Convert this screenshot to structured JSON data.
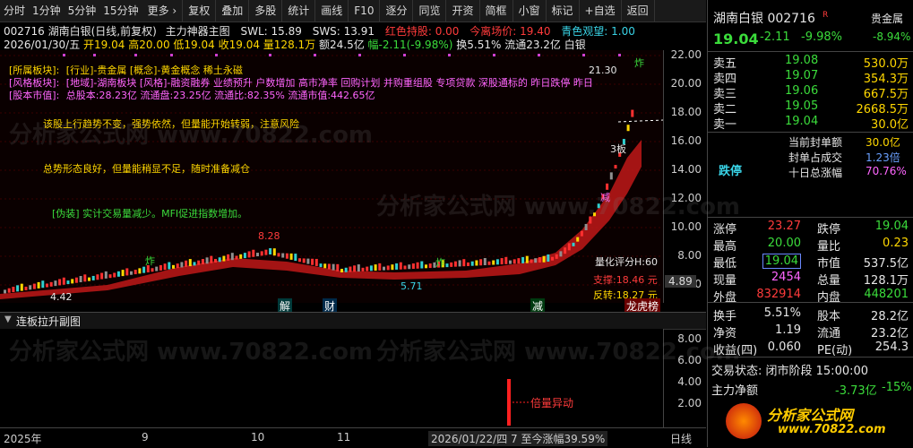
{
  "toolbar": {
    "periods": [
      "分时",
      "1分钟",
      "5分钟",
      "15分钟",
      "更多 ›"
    ],
    "buttons": [
      "复权",
      "叠加",
      "多股",
      "统计",
      "画线",
      "F10",
      "逐分",
      "同览",
      "开资",
      "简框",
      "小窗",
      "标记",
      "+自选",
      "返回"
    ]
  },
  "header": {
    "code_name": "002716 湖南白银(日线,前复权)",
    "indicator": "主力神器主图",
    "swl": "SWL: 15.89",
    "sws": "SWS: 13.91",
    "red_hold": "红色持股: 0.00",
    "today_sell": "今离场价: 19.40",
    "cyan_watch": "青色观望: 1.00"
  },
  "quote_line": {
    "date": "2026/01/30/五",
    "open": "开19.04",
    "high": "高20.00",
    "low": "低19.04",
    "close": "收19.04",
    "vol": "量128.1万",
    "amount": "额24.5亿",
    "change": "幅-2.11(-9.98%)",
    "turnover": "换5.51%",
    "float_cap": "流通23.2亿",
    "metal": "白银"
  },
  "board_info": {
    "row1_label": "[所属板块]:",
    "row1_value": "[行业]-贵金属 [概念]-黄金概念 稀土永磁",
    "row2_label": "[风格板块]:",
    "row2_value": "[地域]-湖南板块 [风格]-融资融券 业绩预升 户数增加 高市净率 回购计划 并购重组股 专项贷款 深股通标的 昨日跌停 昨日",
    "row3_label": "[股本市值]:",
    "row3_value": "总股本:28.23亿 流通盘:23.25亿 流通比:82.35% 流通市值:442.65亿"
  },
  "commentary": {
    "c1": "该股上行趋势不变，强势依然，但量能开始转弱，注意风险",
    "c2": "总势形态良好，但量能稍显不足，随时准备减仓",
    "c3": "[伪装]  实计交易量减少。MFI促进指数增加。"
  },
  "chart_labels": {
    "high_mark": "21.30",
    "peak_small": "8.28",
    "low_mark": "4.42",
    "trough": "5.71",
    "board3": "3板",
    "score": "量化评分H:60",
    "support": "支撑:18.46 元",
    "reversal": "反转:18.27 元",
    "right_price": "4.89",
    "zha": "炸",
    "mid_tag": "减"
  },
  "y_axis": [
    "22.00",
    "20.00",
    "18.00",
    "16.00",
    "14.00",
    "12.00",
    "10.00",
    "8.00",
    "6.00"
  ],
  "events": [
    "解",
    "财",
    "减",
    "龙虎榜"
  ],
  "sub_panel": {
    "title": "连板拉升副图",
    "ticks": [
      "8.00",
      "6.00",
      "4.00",
      "2.00"
    ],
    "annotation": "倍量异动"
  },
  "x_axis": [
    "2025年",
    "9",
    "10",
    "11",
    "2026/01/22/四 7 至今涨幅39.59%",
    "日线"
  ],
  "right_panel": {
    "title": "湖南白银 002716",
    "r_badge": "R",
    "sector": "贵金属",
    "price": "19.04",
    "chg": "-2.11",
    "pct": "-9.98%",
    "sector_pct": "-8.94%",
    "asks": [
      {
        "label": "卖五",
        "price": "19.08",
        "vol": "530.0万"
      },
      {
        "label": "卖四",
        "price": "19.07",
        "vol": "354.3万"
      },
      {
        "label": "卖三",
        "price": "19.06",
        "vol": "667.5万"
      },
      {
        "label": "卖二",
        "price": "19.05",
        "vol": "2668.5万"
      },
      {
        "label": "卖一",
        "price": "19.04",
        "vol": "30.0亿"
      }
    ],
    "limit_state": "跌停",
    "seal_rows": [
      {
        "label": "当前封单额",
        "value": "30.0亿"
      },
      {
        "label": "封单占成交",
        "value": "1.23倍"
      },
      {
        "label": "十日总涨幅",
        "value": "70.76%"
      }
    ],
    "stats": [
      {
        "l1": "涨停",
        "v1": "23.27",
        "l2": "跌停",
        "v2": "19.04"
      },
      {
        "l1": "最高",
        "v1": "20.00",
        "l2": "量比",
        "v2": "0.23"
      },
      {
        "l1": "最低",
        "v1": "19.04",
        "l2": "市值",
        "v2": "537.5亿"
      },
      {
        "l1": "现量",
        "v1": "2454",
        "l2": "总量",
        "v2": "128.1万"
      },
      {
        "l1": "外盘",
        "v1": "832914",
        "l2": "内盘",
        "v2": "448201"
      }
    ],
    "stats2": [
      {
        "l1": "换手",
        "v1": "5.51%",
        "l2": "股本",
        "v2": "28.2亿"
      },
      {
        "l1": "净资",
        "v1": "1.19",
        "l2": "流通",
        "v2": "23.2亿"
      },
      {
        "l1": "收益(四)",
        "v1": "0.060",
        "l2": "PE(动)",
        "v2": "254.3"
      }
    ],
    "trade_state": "交易状态: 闭市阶段 15:00:00",
    "main_flow_label": "主力净额",
    "main_flow_value": "-3.73亿",
    "main_flow_pct": "-15%",
    "brand": "分析家公式网",
    "brand_url": "www.70822.com"
  },
  "watermark": "分析家公式网 www.70822.com",
  "colors": {
    "up": "#ff3b3b",
    "down": "#3bdc3b",
    "accent": "#39d3e6",
    "gold": "#ffd700"
  }
}
